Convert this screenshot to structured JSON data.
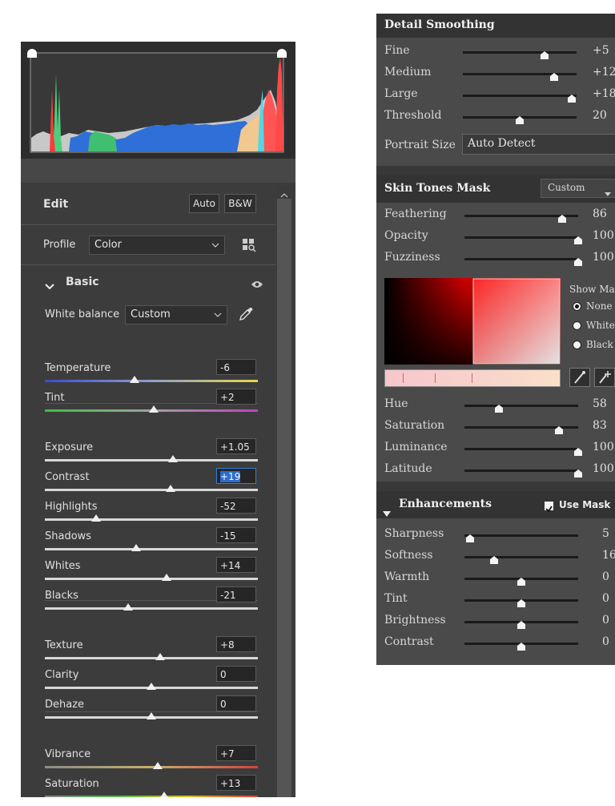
{
  "edit_panel": {
    "title": "Edit",
    "auto_label": "Auto",
    "bw_label": "B&W",
    "profile_label": "Profile",
    "profile_value": "Color",
    "basic_label": "Basic",
    "white_balance_label": "White balance",
    "white_balance_value": "Custom",
    "sliders": [
      {
        "label": "Temperature",
        "value": "-6",
        "pos": 0.42
      },
      {
        "label": "Tint",
        "value": "+2",
        "pos": 0.51
      },
      {
        "label": "Exposure",
        "value": "+1.05",
        "pos": 0.6
      },
      {
        "label": "Contrast",
        "value": "+19",
        "pos": 0.59
      },
      {
        "label": "Highlights",
        "value": "-52",
        "pos": 0.24
      },
      {
        "label": "Shadows",
        "value": "-15",
        "pos": 0.43
      },
      {
        "label": "Whites",
        "value": "+14",
        "pos": 0.57
      },
      {
        "label": "Blacks",
        "value": "-21",
        "pos": 0.39
      },
      {
        "label": "Texture",
        "value": "+8",
        "pos": 0.54
      },
      {
        "label": "Clarity",
        "value": "0",
        "pos": 0.5
      },
      {
        "label": "Dehaze",
        "value": "0",
        "pos": 0.5
      },
      {
        "label": "Vibrance",
        "value": "+7",
        "pos": 0.53
      },
      {
        "label": "Saturation",
        "value": "+13",
        "pos": 0.56
      }
    ]
  },
  "smoothing_panel": {
    "detail_title": "Detail Smoothing",
    "detail_sliders": [
      {
        "label": "Fine",
        "value": "+5",
        "pos": 0.72
      },
      {
        "label": "Medium",
        "value": "+12",
        "pos": 0.8
      },
      {
        "label": "Large",
        "value": "+18",
        "pos": 0.96
      },
      {
        "label": "Threshold",
        "value": "20",
        "pos": 0.5
      }
    ],
    "portrait_size_label": "Portrait Size",
    "portrait_size_value": "Auto Detect",
    "skin_title": "Skin Tones Mask",
    "skin_preset_value": "Custom",
    "skin_sliders": [
      {
        "label": "Feathering",
        "value": "86",
        "pos": 0.86
      },
      {
        "label": "Opacity",
        "value": "100",
        "pos": 1.0
      },
      {
        "label": "Fuzziness",
        "value": "100",
        "pos": 1.0
      }
    ],
    "show_mask_label": "Show Mask",
    "show_mask_options": [
      "None",
      "White",
      "Black"
    ],
    "color_sliders": [
      {
        "label": "Hue",
        "value": "58",
        "pos": 0.3
      },
      {
        "label": "Saturation",
        "value": "83",
        "pos": 0.83
      },
      {
        "label": "Luminance",
        "value": "100",
        "pos": 1.0
      },
      {
        "label": "Latitude",
        "value": "100",
        "pos": 1.0
      }
    ],
    "enhance_title": "Enhancements",
    "use_mask_label": "Use Mask",
    "enhance_sliders": [
      {
        "label": "Sharpness",
        "value": "5",
        "pos": 0.05
      },
      {
        "label": "Softness",
        "value": "16",
        "pos": 0.26
      },
      {
        "label": "Warmth",
        "value": "0",
        "pos": 0.5
      },
      {
        "label": "Tint",
        "value": "0",
        "pos": 0.5
      },
      {
        "label": "Brightness",
        "value": "0",
        "pos": 0.5
      },
      {
        "label": "Contrast",
        "value": "0",
        "pos": 0.5
      }
    ]
  }
}
